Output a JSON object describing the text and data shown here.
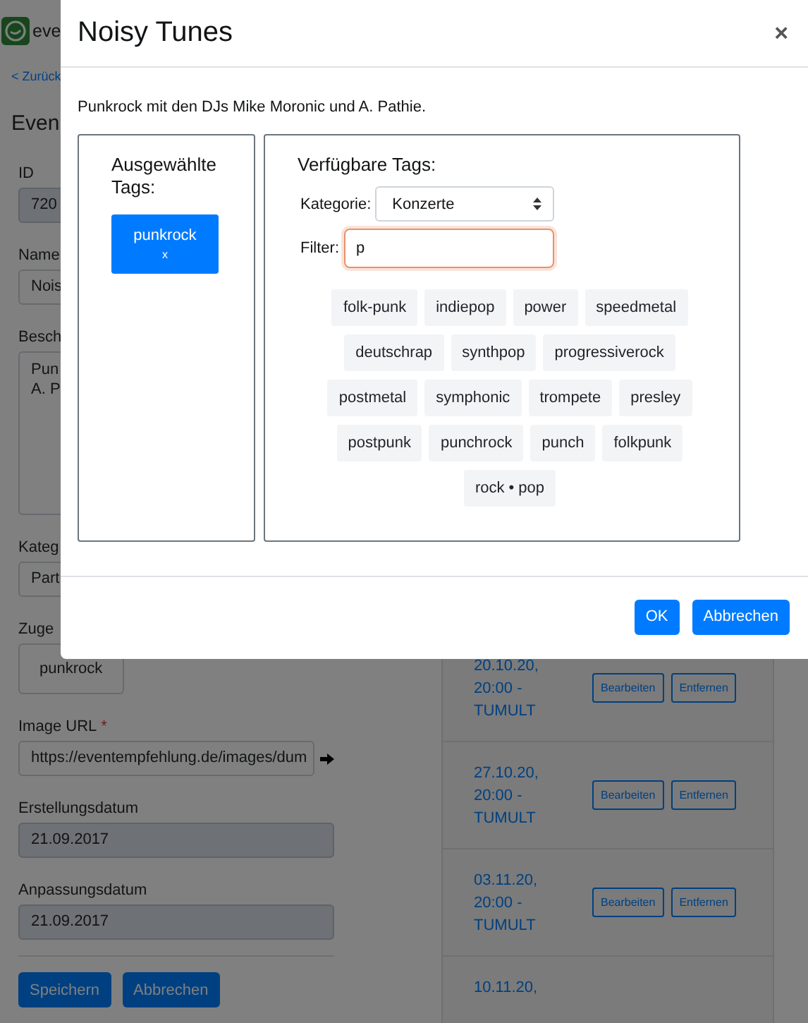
{
  "app": {
    "logo_text": "eve",
    "back_link": "< Zurück",
    "heading": "Even"
  },
  "form": {
    "fields": [
      {
        "kind": "input",
        "label": "ID",
        "value": "720",
        "disabled": true
      },
      {
        "kind": "input",
        "label": "Name",
        "value": "Nois",
        "disabled": false
      },
      {
        "kind": "textarea",
        "label": "Besch",
        "lines": [
          "Pun",
          "A. P"
        ],
        "disabled": false
      },
      {
        "kind": "select",
        "label": "Kateg",
        "value": "Part",
        "disabled": false
      },
      {
        "kind": "tags",
        "label": "Zuge",
        "tags": [
          "punkrock"
        ]
      },
      {
        "kind": "url",
        "label": "Image URL",
        "required_mark": "*",
        "value": "https://eventempfehlung.de/images/dum",
        "disabled": false
      },
      {
        "kind": "input",
        "label": "Erstellungsdatum",
        "value": "21.09.2017",
        "disabled": true
      },
      {
        "kind": "input",
        "label": "Anpassungsdatum",
        "value": "21.09.2017",
        "disabled": true
      }
    ],
    "buttons": [
      "Speichern",
      "Abbrechen"
    ]
  },
  "events": [
    {
      "date": "20.10.20, 20:00 - TUMULT",
      "buttons": [
        "Bearbeiten",
        "Entfernen"
      ]
    },
    {
      "date": "27.10.20, 20:00 - TUMULT",
      "buttons": [
        "Bearbeiten",
        "Entfernen"
      ]
    },
    {
      "date": "03.11.20, 20:00 - TUMULT",
      "buttons": [
        "Bearbeiten",
        "Entfernen"
      ]
    },
    {
      "date": "10.11.20,"
    }
  ],
  "modal": {
    "title": "Noisy Tunes",
    "close": "×",
    "description": "Punkrock mit den DJs Mike Moronic und A. Pathie.",
    "selected_panel": {
      "heading": "Ausgewählte Tags:",
      "tags": [
        {
          "label": "punkrock",
          "remove": "x"
        }
      ]
    },
    "available_panel": {
      "heading": "Verfügbare Tags:",
      "category_label": "Kategorie:",
      "category_value": "Konzerte",
      "filter_label": "Filter:",
      "filter_value": "p",
      "filter_focused": true,
      "tags": [
        "folk-punk",
        "indiepop",
        "power",
        "speedmetal",
        "deutschrap",
        "synthpop",
        "progressiverock",
        "postmetal",
        "symphonic",
        "trompete",
        "presley",
        "postpunk",
        "punchrock",
        "punch",
        "folkpunk",
        "rock • pop"
      ]
    },
    "buttons": [
      "OK",
      "Abbrechen"
    ]
  }
}
